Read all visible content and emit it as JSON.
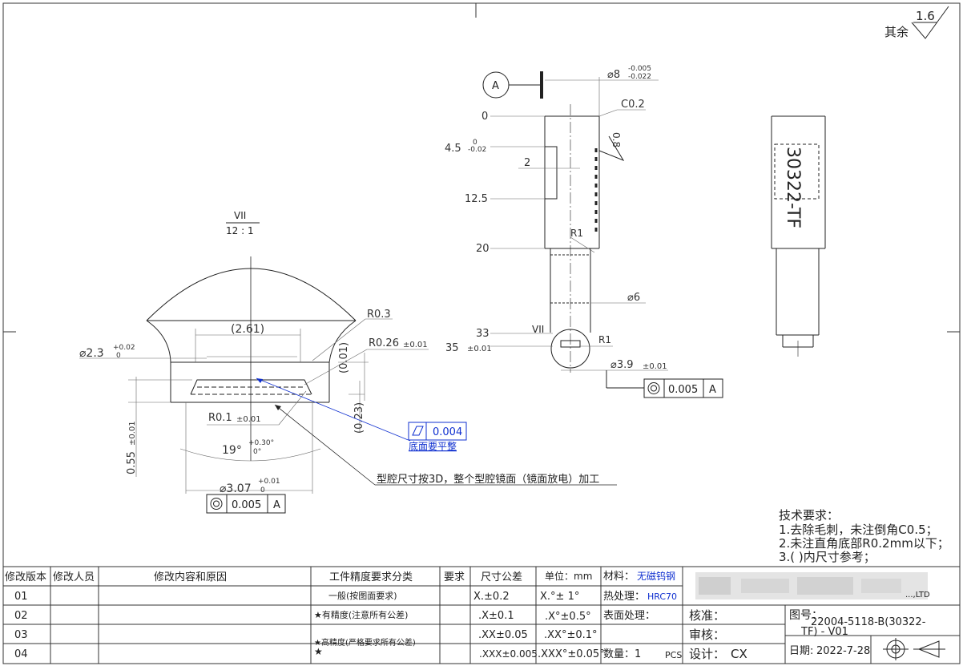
{
  "surface": {
    "roughness": "1.6",
    "label": "其余"
  },
  "detail_view": {
    "name": "VII",
    "scale": "12 : 1"
  },
  "detail": {
    "dia_2_3": "⌀2.3",
    "dia_2_3_tol_up": "+0.02",
    "dia_2_3_tol_dn": "0",
    "width_2_61": "(2.61)",
    "r_0_3": "R0.3",
    "r_0_26": "R0.26",
    "r_0_26_tol": "±0.01",
    "depth_0_01": "(0.01)",
    "depth_0_23": "(0.23)",
    "r_0_1": "R0.1",
    "r_0_1_tol": "±0.01",
    "height_0_55": "0.55",
    "height_0_55_tol": "±0.01",
    "angle_19": "19°",
    "angle_19_tol_up": "+0.30°",
    "angle_19_tol_dn": "0°",
    "dia_3_07": "⌀3.07",
    "dia_3_07_tol_up": "+0.01",
    "dia_3_07_tol_dn": "0",
    "flatness_value": "0.004",
    "flatness_note": "底面要平整",
    "coax_value": "0.005",
    "coax_datum": "A",
    "cavity_note": "型腔尺寸按3D，整个型腔镜面（镜面放电）加工"
  },
  "main_view": {
    "datum": "A",
    "dia_8": "⌀8",
    "dia_8_tol_up": "-0.005",
    "dia_8_tol_dn": "-0.022",
    "chamfer": "C0.2",
    "pos_0": "0",
    "pos_4_5": "4.5",
    "pos_4_5_tol_up": "0",
    "pos_4_5_tol_dn": "-0.02",
    "dim_2": "2",
    "pos_12_5": "12.5",
    "pos_20": "20",
    "roughness_0_8": "0.8",
    "r1_top": "R1",
    "dia_6": "⌀6",
    "pos_33": "33",
    "detail_callout": "VII",
    "pos_35": "35",
    "pos_35_tol": "±0.01",
    "r1_bottom": "R1",
    "dia_3_9": "⌀3.9",
    "dia_3_9_tol": "±0.01",
    "coax_value": "0.005",
    "coax_datum": "A"
  },
  "side_view": {
    "engraving": "30322-TF"
  },
  "tech_requirements": {
    "title": "技术要求：",
    "items": [
      "1.去除毛刺，未注倒角C0.5；",
      "2.未注直角底部R0.2mm以下；",
      "3.( )内尺寸参考；"
    ]
  },
  "title_block": {
    "headers": [
      "修改版本",
      "修改人员",
      "修改内容和原因",
      "工件精度要求分类",
      "要求",
      "尺寸公差",
      "单位：mm"
    ],
    "rows": [
      {
        "version": "01",
        "class": "一般(按图面要求)",
        "tol": "X.±0.2",
        "ang": "X.°± 1°"
      },
      {
        "version": "02",
        "class": "★有精度(注意所有公差)",
        "tol": ".X±0.1",
        "ang": ".X°±0.5°"
      },
      {
        "version": "03",
        "class": "★高精度(严格要求所有公差)",
        "tol": ".XX±0.05",
        "ang": ".XX°±0.1°"
      },
      {
        "version": "04",
        "class": "★",
        "tol": ".XXX±0.005",
        "ang": ".XXX°±0.05°"
      }
    ],
    "material_label": "材料：",
    "material_value": "无磁钨钢",
    "heat_label": "热处理：",
    "heat_value": "HRC70",
    "surface_label": "表面处理：",
    "qty_label": "数量：",
    "qty_value": "1",
    "qty_unit": "PCS",
    "approve_label": "核准：",
    "review_label": "审核：",
    "design_label": "设计：",
    "design_value": "CX",
    "drawing_no_label": "图号：",
    "drawing_no_line1": "22004-5118-B(30322-",
    "drawing_no_line2": "TF) - V01",
    "date_label": "日期:",
    "date_value": "2022-7-28",
    "company_suffix": "...,LTD"
  }
}
